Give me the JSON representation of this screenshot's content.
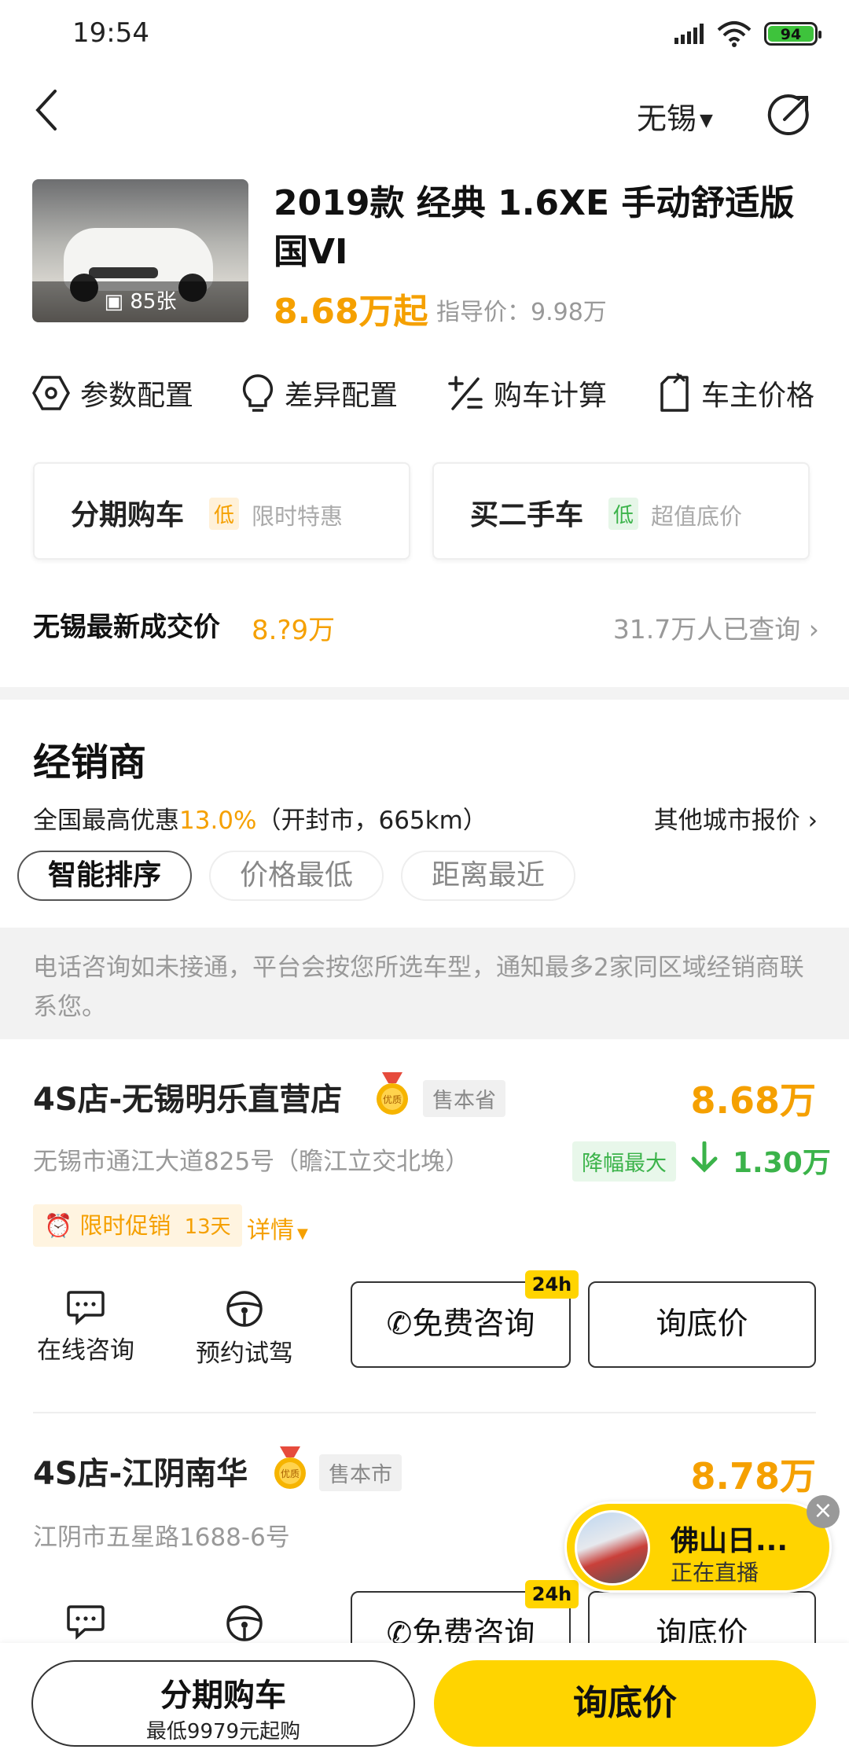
{
  "status": {
    "time": "19:54",
    "battery": "94"
  },
  "header": {
    "city": "无锡"
  },
  "car": {
    "photo_count": "85张",
    "title": "2019款 经典 1.6XE 手动舒适版 国VI",
    "price": "8.68万起",
    "guide_price": "指导价：9.98万"
  },
  "quick_links": [
    {
      "label": "参数配置",
      "icon": "hexagon-icon"
    },
    {
      "label": "差异配置",
      "icon": "bulb-icon"
    },
    {
      "label": "购车计算",
      "icon": "calculator-icon"
    },
    {
      "label": "车主价格",
      "icon": "tag-icon"
    }
  ],
  "cards": [
    {
      "title": "分期购车",
      "tag": "低",
      "sub": "限时特惠",
      "tag_color": "#f5a000"
    },
    {
      "title": "买二手车",
      "tag": "低",
      "sub": "超值底价",
      "tag_color": "#3bb34a"
    }
  ],
  "deal": {
    "label": "无锡最新成交价",
    "value": "8.?9万",
    "queries": "31.7万人已查询"
  },
  "dealers_section": {
    "title": "经销商",
    "discount_prefix": "全国最高优惠",
    "discount_value": "13.0%",
    "discount_suffix": "（开封市，665km）",
    "other_city": "其他城市报价",
    "sort_tabs": [
      "智能排序",
      "价格最低",
      "距离最近"
    ],
    "notice": "电话咨询如未接通，平台会按您所选车型，通知最多2家同区域经销商联系您。"
  },
  "dealers": [
    {
      "name": "4S店-无锡明乐直营店",
      "sell_tag": "售本省",
      "price": "8.68万",
      "address": "无锡市通江大道825号（瞻江立交北堍）",
      "drop_tag": "降幅最大",
      "drop_value": "1.30万",
      "promo": "限时促销",
      "promo_days": "13天",
      "promo_detail": "详情"
    },
    {
      "name": "4S店-江阴南华",
      "sell_tag": "售本市",
      "price": "8.78万",
      "address": "江阴市五星路1688-6号"
    }
  ],
  "actions": {
    "online": "在线咨询",
    "test_drive": "预约试驾",
    "free_consult": "免费咨询",
    "badge_24h": "24h",
    "lowest_price": "询底价"
  },
  "medal_text": "优质",
  "live": {
    "name": "佛山日...",
    "status": "正在直播"
  },
  "bottom": {
    "installment": "分期购车",
    "installment_sub": "最低9979元起购",
    "ask_price": "询底价"
  },
  "colors": {
    "accent": "#ffd400",
    "price": "#f5a000",
    "green": "#3bb34a"
  }
}
